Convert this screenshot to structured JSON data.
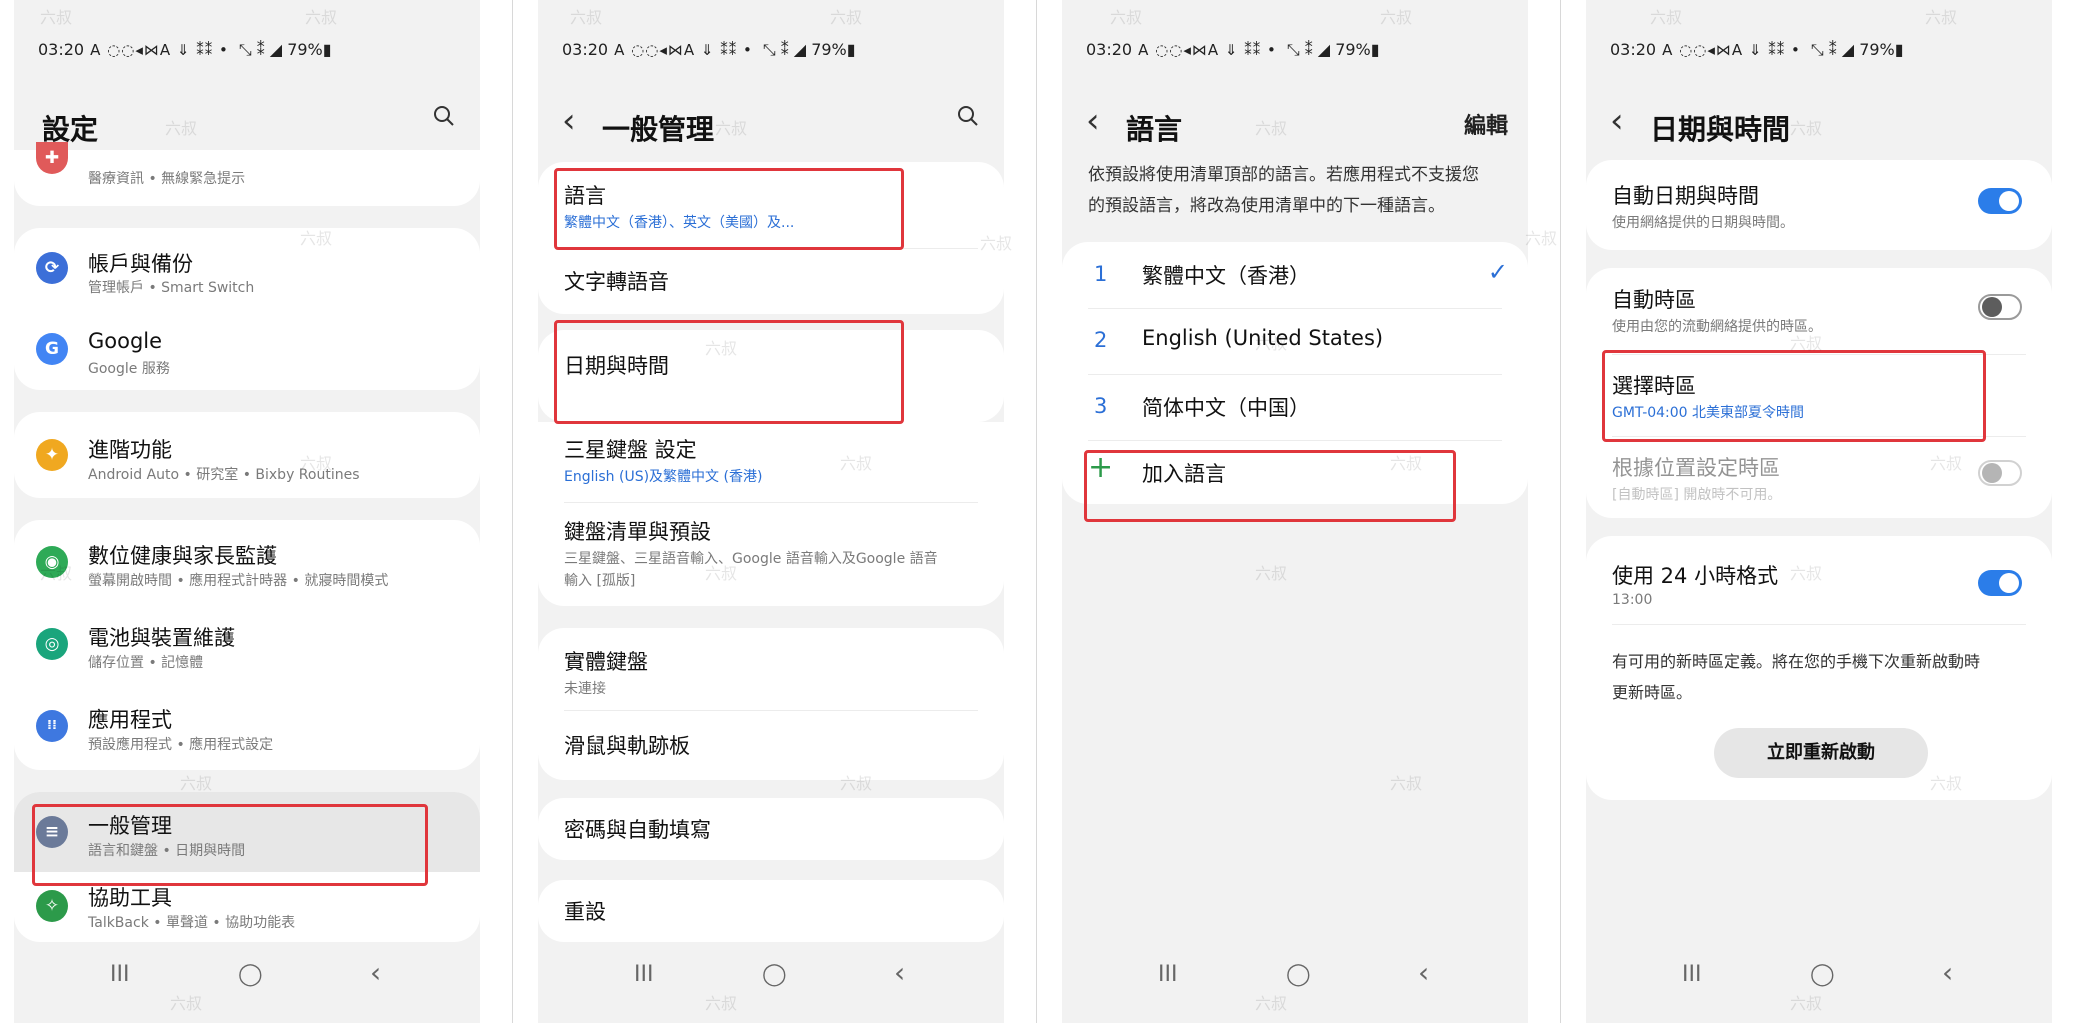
{
  "status": {
    "time": "03:20",
    "icons": "A ◌◌◂⋈A ⇓ ⁑⁑ •",
    "right": "⤡ ⁑ ◢ 79%▮"
  },
  "nav": {
    "recents": "III",
    "home": "◯",
    "back": "‹"
  },
  "watermark": "六叔",
  "s1": {
    "title": "設定",
    "items": [
      {
        "title": "",
        "sub": "醫療資訊 • 無線緊急提示",
        "color": "#e05a5a",
        "glyph": "✚"
      },
      {
        "title": "帳戶與備份",
        "sub": "管理帳戶 • Smart Switch",
        "color": "#3c6fd8",
        "glyph": "⟳"
      },
      {
        "title": "Google",
        "sub": "Google 服務",
        "color": "#4285f4",
        "glyph": "G"
      },
      {
        "title": "進階功能",
        "sub": "Android Auto • 研究室 • Bixby Routines",
        "color": "#f0a820",
        "glyph": "✦"
      },
      {
        "title": "數位健康與家長監護",
        "sub": "螢幕開啟時間 • 應用程式計時器 • 就寢時間模式",
        "color": "#2eaa57",
        "glyph": "◉"
      },
      {
        "title": "電池與裝置維護",
        "sub": "儲存位置 • 記憶體",
        "color": "#1aa57c",
        "glyph": "◎"
      },
      {
        "title": "應用程式",
        "sub": "預設應用程式 • 應用程式設定",
        "color": "#3e78e0",
        "glyph": "⁞⁞"
      },
      {
        "title": "一般管理",
        "sub": "語言和鍵盤 • 日期與時間",
        "color": "#6b7a99",
        "glyph": "≡"
      },
      {
        "title": "協助工具",
        "sub": "TalkBack • 單聲道 • 協助功能表",
        "color": "#2c9a4a",
        "glyph": "✧"
      }
    ]
  },
  "s2": {
    "title": "一般管理",
    "items": [
      {
        "title": "語言",
        "sub": "繁體中文（香港）、英文（美國）及..."
      },
      {
        "title": "文字轉語音",
        "sub": ""
      },
      {
        "title": "日期與時間",
        "sub": ""
      },
      {
        "title": "三星鍵盤 設定",
        "sub": "English (US)及繁體中文 (香港)"
      },
      {
        "title": "鍵盤清單與預設",
        "sub": "三星鍵盤、三星語音輸入、Google 語音輸入及Google 語音",
        "sub2": "輸入 [孤版]"
      },
      {
        "title": "實體鍵盤",
        "sub": "未連接"
      },
      {
        "title": "滑鼠與軌跡板",
        "sub": ""
      },
      {
        "title": "密碼與自動填寫",
        "sub": ""
      },
      {
        "title": "重設",
        "sub": ""
      }
    ]
  },
  "s3": {
    "title": "語言",
    "edit": "編輯",
    "desc1": "依預設將使用清單頂部的語言。若應用程式不支援您",
    "desc2": "的預設語言，將改為使用清單中的下一種語言。",
    "langs": [
      {
        "num": "1",
        "name": "繁體中文（香港）"
      },
      {
        "num": "2",
        "name": "English (United States)"
      },
      {
        "num": "3",
        "name": "简体中文（中国）"
      }
    ],
    "check": "✓",
    "add_icon": "+",
    "add": "加入語言"
  },
  "s4": {
    "title": "日期與時間",
    "auto_dt": {
      "title": "自動日期與時間",
      "sub": "使用網絡提供的日期與時間。",
      "on": true
    },
    "auto_tz": {
      "title": "自動時區",
      "sub": "使用由您的流動網絡提供的時區。",
      "on": false
    },
    "select_tz": {
      "title": "選擇時區",
      "sub": "GMT-04:00 北美東部夏令時間"
    },
    "loc_tz": {
      "title": "根據位置設定時區",
      "sub": "[自動時區] 開啟時不可用。"
    },
    "h24": {
      "title": "使用 24 小時格式",
      "sub": "13:00",
      "on": true
    },
    "note1": "有可用的新時區定義。將在您的手機下次重新啟動時",
    "note2": "更新時區。",
    "restart": "立即重新啟動"
  },
  "colors": {
    "accent": "#2b6fd6",
    "highlight": "#e0363c",
    "toggle_on": "#2b7de9"
  }
}
